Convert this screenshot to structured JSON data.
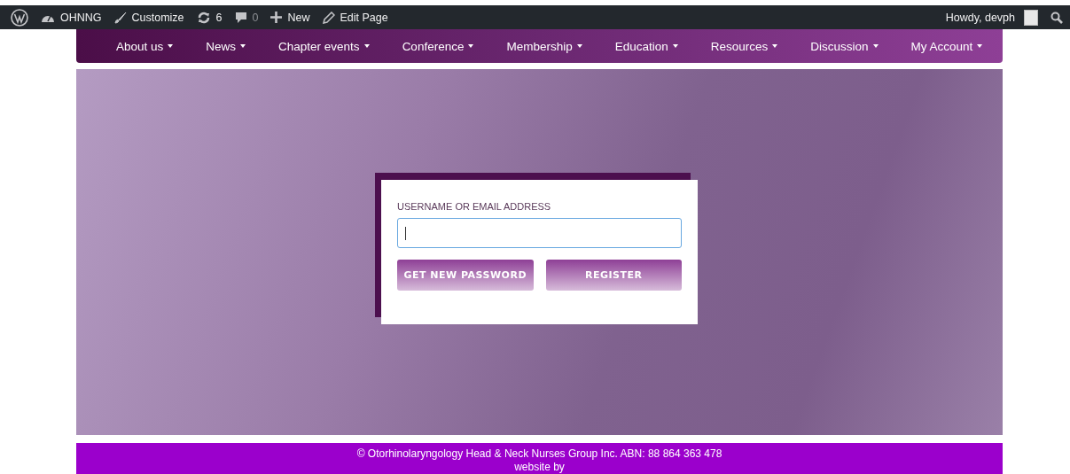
{
  "admin_bar": {
    "site": "OHNNG",
    "customize": "Customize",
    "updates": "6",
    "comments": "0",
    "new": "New",
    "edit": "Edit Page",
    "greeting": "Howdy, devph"
  },
  "nav": [
    {
      "label": "About us"
    },
    {
      "label": "News"
    },
    {
      "label": "Chapter events"
    },
    {
      "label": "Conference"
    },
    {
      "label": "Membership"
    },
    {
      "label": "Education"
    },
    {
      "label": "Resources"
    },
    {
      "label": "Discussion"
    },
    {
      "label": "My Account"
    }
  ],
  "form": {
    "label": "USERNAME OR EMAIL ADDRESS",
    "buttons": [
      "GET NEW PASSWORD",
      "REGISTER"
    ]
  },
  "footer": {
    "lines": [
      "© Otorhinolaryngology Head & Neck Nurses Group Inc. ABN: 88 864 363 478",
      "website by"
    ]
  }
}
